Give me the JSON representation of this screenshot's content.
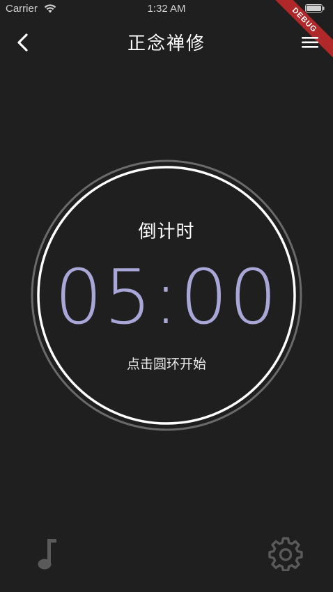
{
  "status_bar": {
    "carrier": "Carrier",
    "time": "1:32 AM"
  },
  "debug_banner": "DEBUG",
  "header": {
    "title": "正念禅修",
    "back_icon": "chevron-left-icon",
    "menu_icon": "hamburger-menu-icon"
  },
  "timer": {
    "label": "倒计时",
    "value": "05:00",
    "hint": "点击圆环开始",
    "value_color": "#a9a7d8"
  },
  "footer": {
    "music_icon": "music-note-icon",
    "settings_icon": "gear-icon"
  },
  "colors": {
    "background": "#1f1f1f",
    "debug_banner": "#b0282a",
    "bottom_icons": "#5a5a5a"
  }
}
